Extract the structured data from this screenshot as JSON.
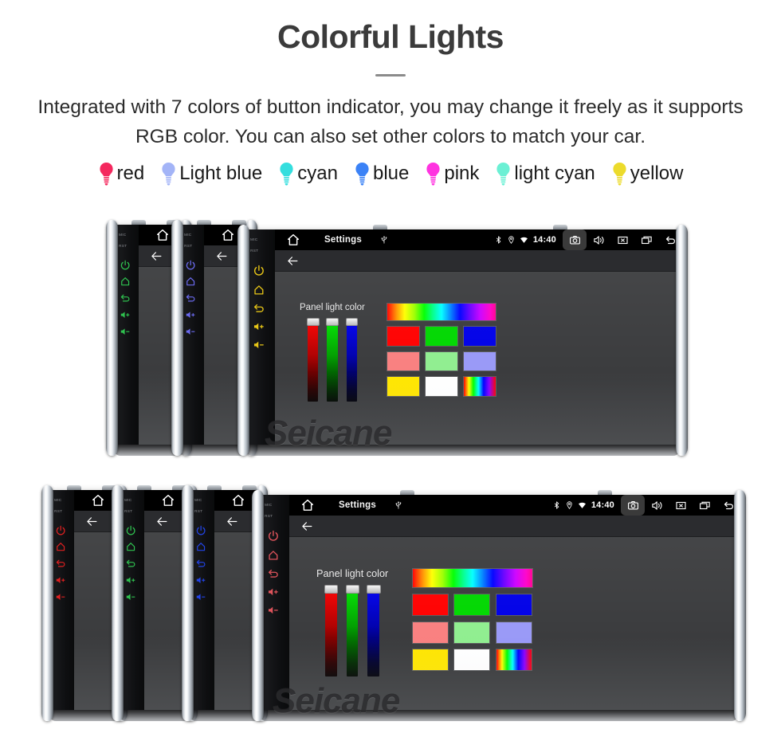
{
  "hero": {
    "title": "Colorful Lights",
    "subtitle": "Integrated with 7 colors of button indicator, you may change it freely as it supports RGB color. You can also set other colors to match your car."
  },
  "legend": {
    "items": [
      {
        "label": "red",
        "color": "#f4285e",
        "icon": "bulb-icon"
      },
      {
        "label": "Light blue",
        "color": "#a3b4f7",
        "icon": "bulb-icon"
      },
      {
        "label": "cyan",
        "color": "#34dede",
        "icon": "bulb-icon"
      },
      {
        "label": "blue",
        "color": "#3b82f6",
        "icon": "bulb-icon"
      },
      {
        "label": "pink",
        "color": "#ff33e0",
        "icon": "bulb-icon"
      },
      {
        "label": "light cyan",
        "color": "#6bf0d4",
        "icon": "bulb-icon"
      },
      {
        "label": "yellow",
        "color": "#ecdb2c",
        "icon": "bulb-icon"
      }
    ]
  },
  "watermark": {
    "text": "Seicane"
  },
  "device": {
    "side_buttons": {
      "mic_label": "MIC",
      "rst_label": "RST",
      "icons": [
        "power-icon",
        "home-icon",
        "back-icon",
        "volume-up-icon",
        "volume-down-icon"
      ]
    },
    "status_bar": {
      "home_icon": "home-icon",
      "title": "Settings",
      "usb_icon": "usb-icon",
      "bluetooth_icon": "bluetooth-icon",
      "location_icon": "location-icon",
      "wifi_icon": "wifi-icon",
      "time": "14:40",
      "keys": [
        {
          "icon": "camera-icon",
          "label": "camera",
          "active": true
        },
        {
          "icon": "volume-icon",
          "label": "volume",
          "active": false
        },
        {
          "icon": "close-icon",
          "label": "close",
          "active": false
        },
        {
          "icon": "recents-icon",
          "label": "recents",
          "active": false
        },
        {
          "icon": "back-icon",
          "label": "back",
          "active": false
        }
      ]
    },
    "back_bar": {
      "icon": "arrow-left-icon"
    },
    "panel": {
      "label": "Panel light color",
      "sliders": [
        {
          "name": "red-slider",
          "channel": "R",
          "color": "#ff0000",
          "value": 100
        },
        {
          "name": "green-slider",
          "channel": "G",
          "color": "#00e800",
          "value": 100
        },
        {
          "name": "blue-slider",
          "channel": "B",
          "color": "#0000f5",
          "value": 100
        }
      ],
      "spectrum_bar": "hue-spectrum",
      "swatches": [
        [
          "#ff0000",
          "#00d700",
          "#0000e8"
        ],
        [
          "#f98080",
          "#90ee90",
          "#9999f7"
        ],
        [
          "#ffe600",
          "#ffffff",
          "rainbow"
        ]
      ]
    }
  },
  "rows": {
    "top": [
      {
        "name": "unit-1",
        "button_color": "#2fc24f",
        "size": "small"
      },
      {
        "name": "unit-2",
        "button_color": "#6b6bf0",
        "size": "small"
      },
      {
        "name": "unit-3",
        "button_color": "#e8c617",
        "size": "large"
      }
    ],
    "bottom": [
      {
        "name": "unit-4",
        "button_color": "#e02020",
        "size": "small"
      },
      {
        "name": "unit-5",
        "button_color": "#2fc24f",
        "size": "small"
      },
      {
        "name": "unit-6",
        "button_color": "#2244e8",
        "size": "small"
      },
      {
        "name": "unit-7",
        "button_color": "#e0545c",
        "size": "large"
      }
    ]
  }
}
